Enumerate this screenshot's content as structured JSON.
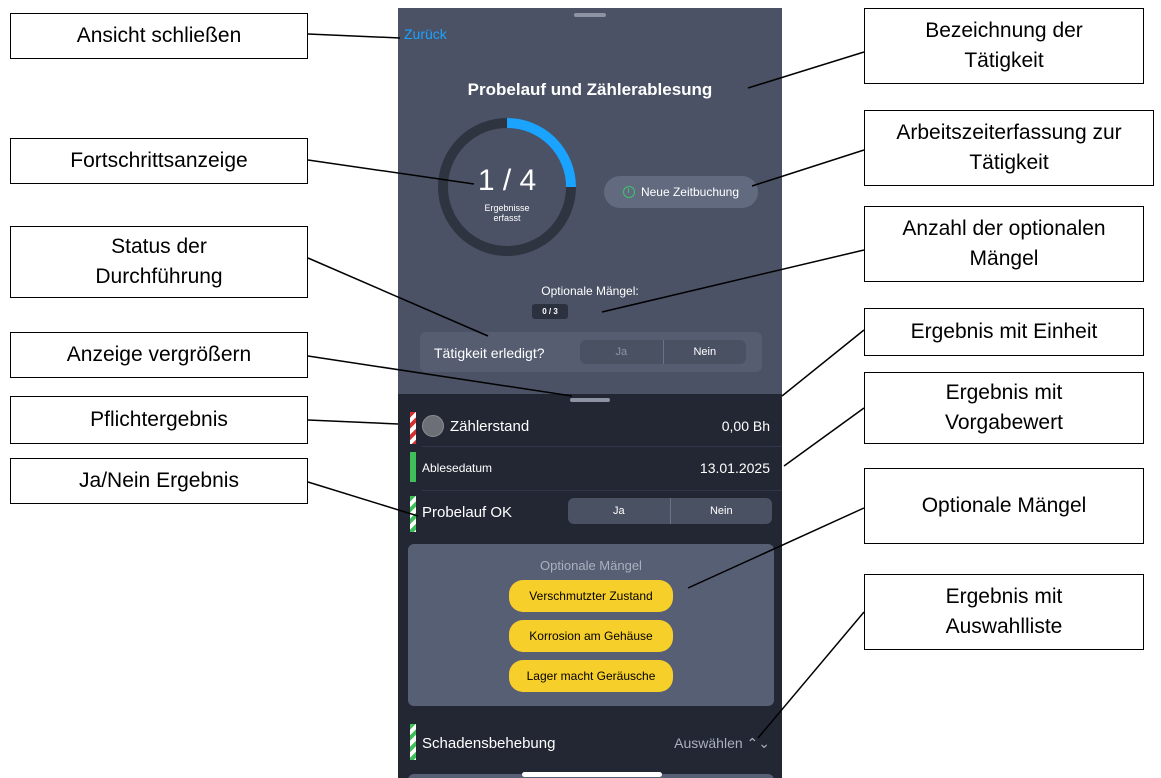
{
  "app": {
    "back_label": "Zurück",
    "activity_title": "Probelauf und Zählerablesung",
    "progress": {
      "done": 1,
      "total": 4,
      "count_text": "1 / 4",
      "label": "Ergebnisse\nerfasst"
    },
    "time_button_label": "Neue Zeitbuchung",
    "optional_defects": {
      "label": "Optionale Mängel:",
      "badge": "0 / 3"
    },
    "done_question": {
      "label": "Tätigkeit erledigt?",
      "yes": "Ja",
      "no": "Nein"
    },
    "results": [
      {
        "label": "Zählerstand",
        "value": "0,00 Bh"
      },
      {
        "label": "Ablesedatum",
        "value": "13.01.2025"
      },
      {
        "label": "Probelauf OK",
        "yes": "Ja",
        "no": "Nein"
      }
    ],
    "defects_card": {
      "title": "Optionale Mängel",
      "items": [
        "Verschmutzter Zustand",
        "Korrosion am Gehäuse",
        "Lager macht Geräusche"
      ]
    },
    "select_row": {
      "label": "Schadensbehebung",
      "value": "Auswählen ⌃⌄"
    }
  },
  "annotations": {
    "close_view": "Ansicht schließen",
    "activity_name": "Bezeichnung der\nTätigkeit",
    "progress_display": "Fortschrittsanzeige",
    "time_tracking": "Arbeitszeiterfassung zur\nTätigkeit",
    "execution_status": "Status der\nDurchführung",
    "optional_defects_count": "Anzahl der optionalen\nMängel",
    "enlarge_view": "Anzeige vergrößern",
    "result_with_unit": "Ergebnis mit Einheit",
    "mandatory_result": "Pflichtergebnis",
    "result_with_default": "Ergebnis mit\nVorgabewert",
    "yes_no_result": "Ja/Nein Ergebnis",
    "optional_defects": "Optionale Mängel",
    "result_with_selection": "Ergebnis mit\nAuswahlliste"
  },
  "colors": {
    "accent": "#1aa3ff",
    "progress_track": "#2f3441",
    "chip": "#f7cf2a",
    "mandatory_bar": "#d43030",
    "result_bar": "#3fbf5a"
  }
}
